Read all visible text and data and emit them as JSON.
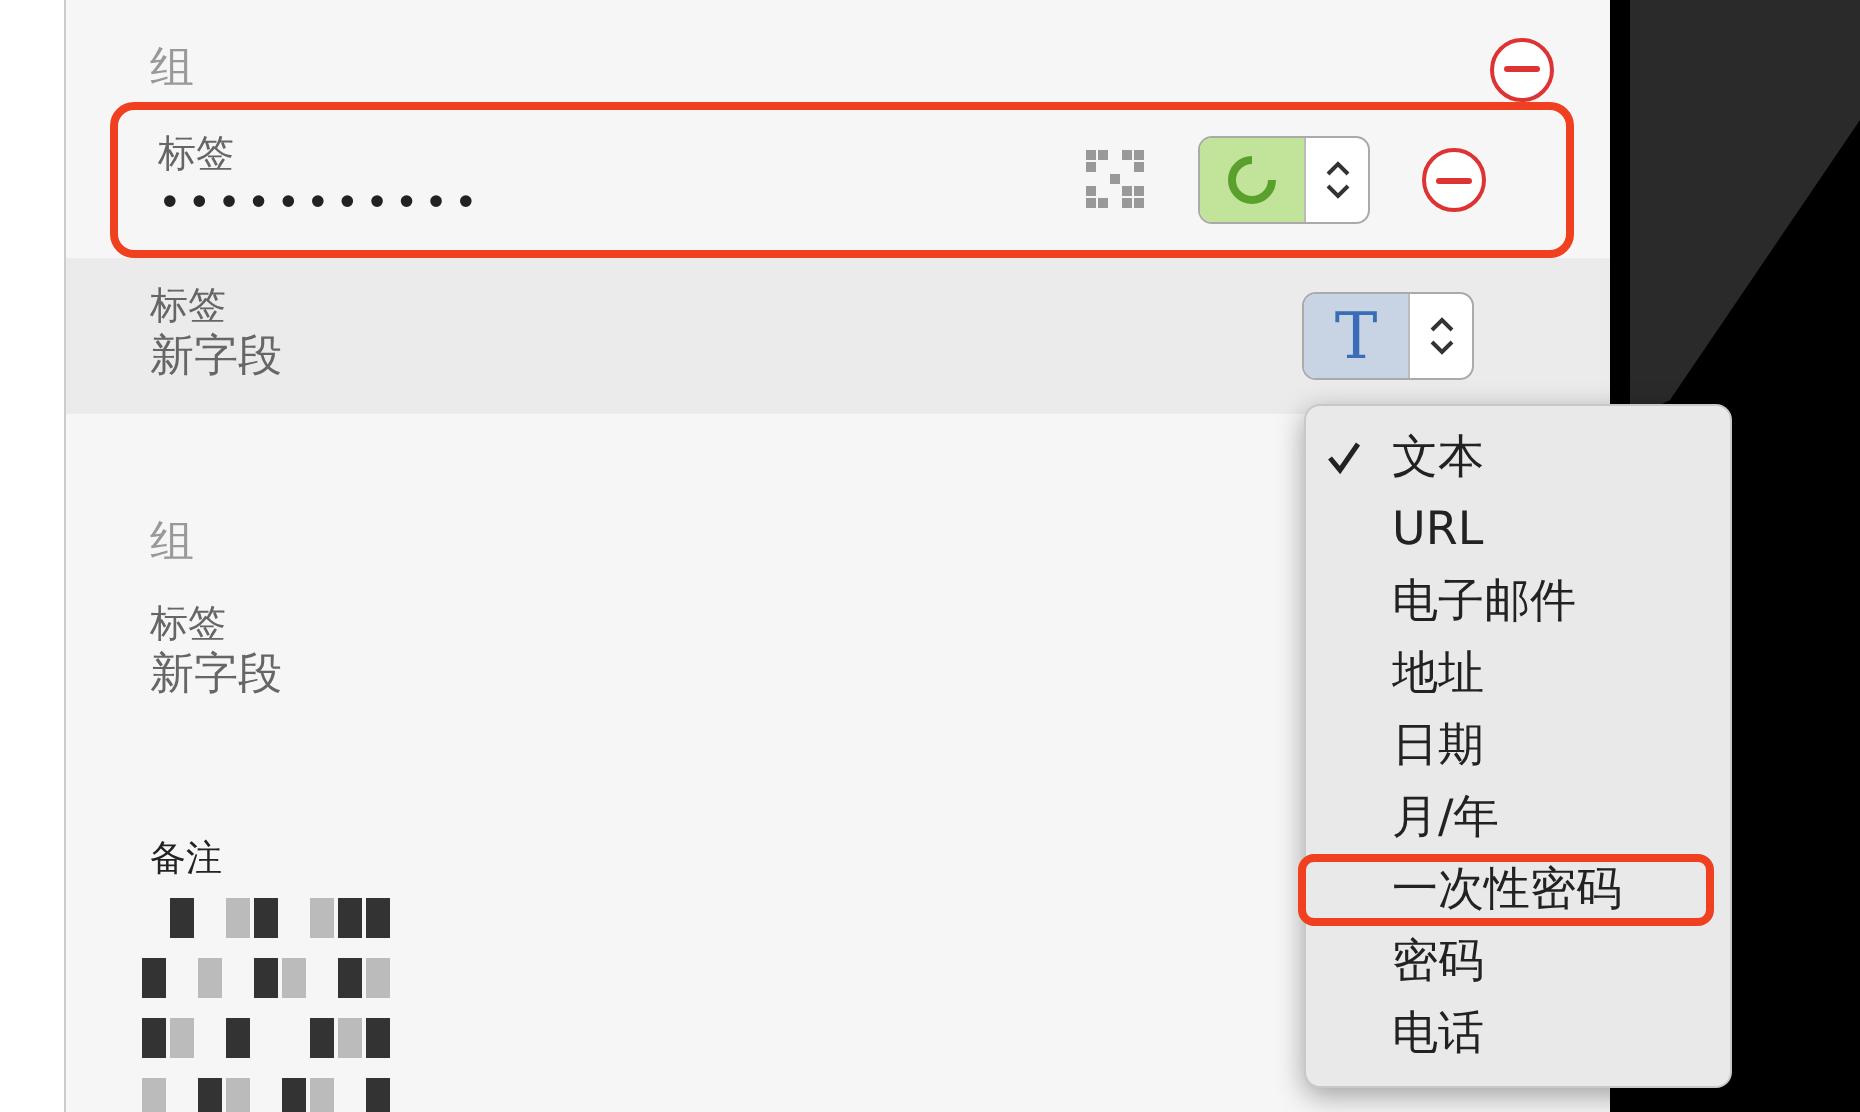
{
  "groups": [
    {
      "title": "组",
      "removable": true,
      "fields": [
        {
          "kind": "otp",
          "label": "标签",
          "value": "•••••••••••",
          "annotated": true,
          "focused": false,
          "removable": true,
          "qr": true
        },
        {
          "kind": "text",
          "label": "标签",
          "value": "新字段",
          "type_glyph": "T",
          "annotated": false,
          "focused": true,
          "removable": false,
          "qr": false
        }
      ]
    },
    {
      "title": "组",
      "fields": [
        {
          "kind": "plain",
          "label": "标签",
          "value": "新字段",
          "annotated": false,
          "focused": false
        }
      ]
    }
  ],
  "notes": {
    "label": "备注"
  },
  "type_menu": {
    "items": [
      {
        "label": "文本",
        "selected": true,
        "annotated": false
      },
      {
        "label": "URL",
        "selected": false,
        "annotated": false
      },
      {
        "label": "电子邮件",
        "selected": false,
        "annotated": false
      },
      {
        "label": "地址",
        "selected": false,
        "annotated": false
      },
      {
        "label": "日期",
        "selected": false,
        "annotated": false
      },
      {
        "label": "月/年",
        "selected": false,
        "annotated": false
      },
      {
        "label": "一次性密码",
        "selected": false,
        "annotated": true
      },
      {
        "label": "密码",
        "selected": false,
        "annotated": false
      },
      {
        "label": "电话",
        "selected": false,
        "annotated": false
      }
    ]
  }
}
